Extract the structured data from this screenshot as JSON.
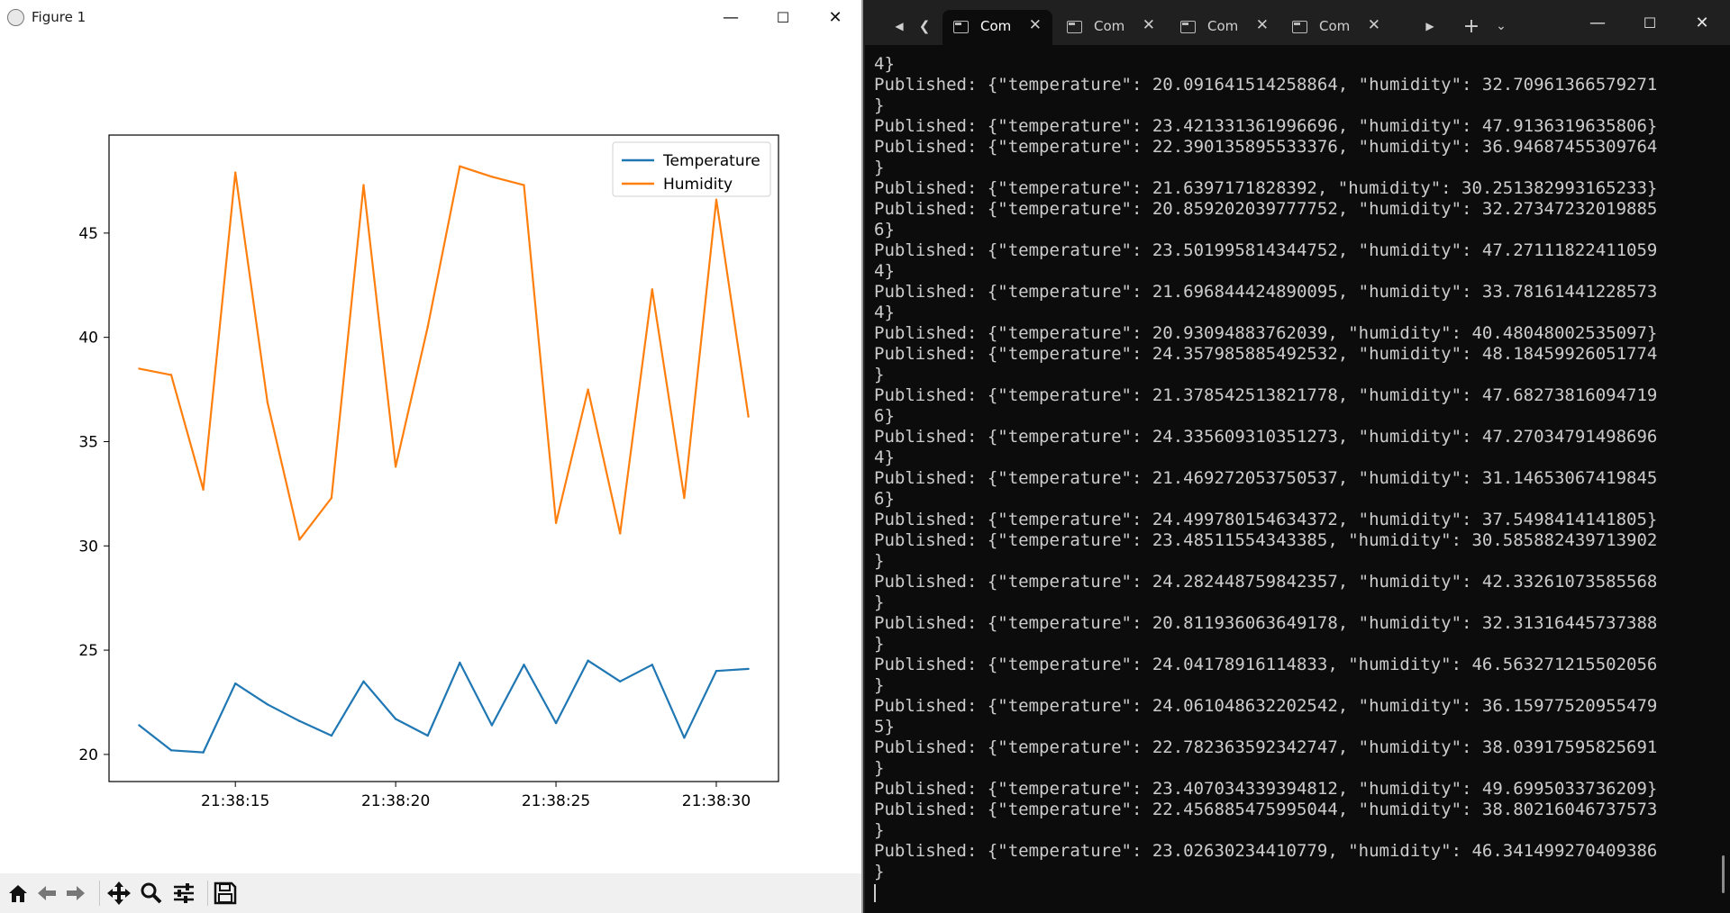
{
  "figure_window": {
    "title": "Figure 1",
    "minimize_glyph": "—",
    "maximize_glyph": "☐",
    "close_glyph": "✕",
    "toolbar": [
      "home-icon",
      "back-icon",
      "forward-icon",
      "pan-icon",
      "zoom-icon",
      "configure-icon",
      "save-icon"
    ]
  },
  "chart_data": {
    "type": "line",
    "title": "",
    "xlabel": "",
    "ylabel": "",
    "x": [
      "21:38:12",
      "21:38:13",
      "21:38:14",
      "21:38:15",
      "21:38:16",
      "21:38:17",
      "21:38:18",
      "21:38:19",
      "21:38:20",
      "21:38:21",
      "21:38:22",
      "21:38:23",
      "21:38:24",
      "21:38:25",
      "21:38:26",
      "21:38:27",
      "21:38:28",
      "21:38:29",
      "21:38:30",
      "21:38:31"
    ],
    "xticks": [
      "21:38:15",
      "21:38:20",
      "21:38:25",
      "21:38:30"
    ],
    "yticks": [
      20,
      25,
      30,
      35,
      40,
      45
    ],
    "ylim": [
      18.7,
      49.7
    ],
    "legend_position": "top-right",
    "grid": false,
    "series": [
      {
        "name": "Temperature",
        "color": "#1f77b4",
        "values": [
          21.4,
          20.2,
          20.1,
          23.4,
          22.4,
          21.6,
          20.9,
          23.5,
          21.7,
          20.9,
          24.4,
          21.4,
          24.3,
          21.5,
          24.5,
          23.5,
          24.3,
          20.8,
          24.0,
          24.1
        ]
      },
      {
        "name": "Humidity",
        "color": "#ff7f0e",
        "values": [
          38.5,
          38.2,
          32.7,
          47.9,
          36.9,
          30.3,
          32.3,
          47.3,
          33.8,
          40.5,
          48.2,
          47.7,
          47.3,
          31.1,
          37.5,
          30.6,
          42.3,
          32.3,
          46.6,
          36.2
        ]
      }
    ]
  },
  "terminal": {
    "tabs": [
      "Com",
      "Com",
      "Com",
      "Com"
    ],
    "tab_close": "✕",
    "lines": [
      "4}",
      "Published: {\"temperature\": 20.091641514258864, \"humidity\": 32.70961366579271",
      "}",
      "Published: {\"temperature\": 23.421331361996696, \"humidity\": 47.9136319635806}",
      "Published: {\"temperature\": 22.390135895533376, \"humidity\": 36.94687455309764",
      "}",
      "Published: {\"temperature\": 21.6397171828392, \"humidity\": 30.251382993165233}",
      "Published: {\"temperature\": 20.859202039777752, \"humidity\": 32.27347232019885",
      "6}",
      "Published: {\"temperature\": 23.501995814344752, \"humidity\": 47.27111822411059",
      "4}",
      "Published: {\"temperature\": 21.696844424890095, \"humidity\": 33.78161441228573",
      "4}",
      "Published: {\"temperature\": 20.93094883762039, \"humidity\": 40.48048002535097}",
      "Published: {\"temperature\": 24.357985885492532, \"humidity\": 48.18459926051774",
      "}",
      "Published: {\"temperature\": 21.378542513821778, \"humidity\": 47.68273816094719",
      "6}",
      "Published: {\"temperature\": 24.335609310351273, \"humidity\": 47.27034791498696",
      "4}",
      "Published: {\"temperature\": 21.469272053750537, \"humidity\": 31.14653067419845",
      "6}",
      "Published: {\"temperature\": 24.499780154634372, \"humidity\": 37.5498414141805}",
      "Published: {\"temperature\": 23.48511554343385, \"humidity\": 30.585882439713902",
      "}",
      "Published: {\"temperature\": 24.282448759842357, \"humidity\": 42.33261073585568",
      "}",
      "Published: {\"temperature\": 20.811936063649178, \"humidity\": 32.31316445737388",
      "}",
      "Published: {\"temperature\": 24.04178916114833, \"humidity\": 46.563271215502056",
      "}",
      "Published: {\"temperature\": 24.061048632202542, \"humidity\": 36.15977520955479",
      "5}",
      "Published: {\"temperature\": 22.782363592342747, \"humidity\": 38.03917595825691",
      "}",
      "Published: {\"temperature\": 23.407034339394812, \"humidity\": 49.6995033736209}",
      "Published: {\"temperature\": 22.456885475995044, \"humidity\": 38.80216046737573",
      "}",
      "Published: {\"temperature\": 23.02630234410779, \"humidity\": 46.341499270409386",
      "}"
    ]
  }
}
